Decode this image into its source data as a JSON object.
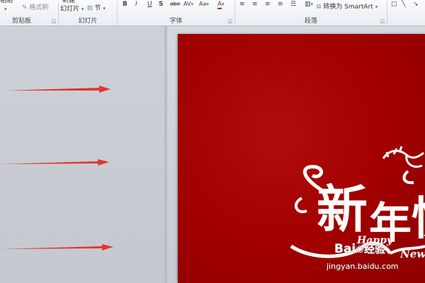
{
  "ribbon": {
    "clipboard": {
      "paste_label": "粘贴",
      "format_painter_label": "格式刷",
      "group_label": "剪贴板"
    },
    "slides": {
      "new_slide_line1": "新建",
      "new_slide_line2": "幻灯片",
      "section_label": "节",
      "group_label": "幻灯片"
    },
    "font": {
      "bold": "B",
      "italic": "I",
      "underline": "U",
      "shadow": "S",
      "strikethrough": "abc",
      "spacing": "AV",
      "case": "Aa",
      "color": "A",
      "group_label": "字体"
    },
    "paragraph": {
      "convert_smartart_label": "转换为 SmartArt",
      "group_label": "段落"
    }
  },
  "slide": {
    "title_chars": [
      "新",
      "年",
      "快"
    ],
    "happy_text": "Happy",
    "new_text": "New"
  },
  "watermark": {
    "logo_text": "Bai",
    "logo_suffix": "经验",
    "url": "jingyan.baidu.com"
  },
  "colors": {
    "slide_red": "#a10000",
    "arrow_red": "#e8332e",
    "pane_gray": "#c9cdd3",
    "ribbon_bg": "#eef1f5"
  },
  "icons": [
    "format-painter-icon",
    "section-icon",
    "bullets-icon",
    "numbering-icon",
    "align-icon",
    "columns-icon",
    "smartart-icon",
    "shape-icon",
    "dragon-icon"
  ]
}
